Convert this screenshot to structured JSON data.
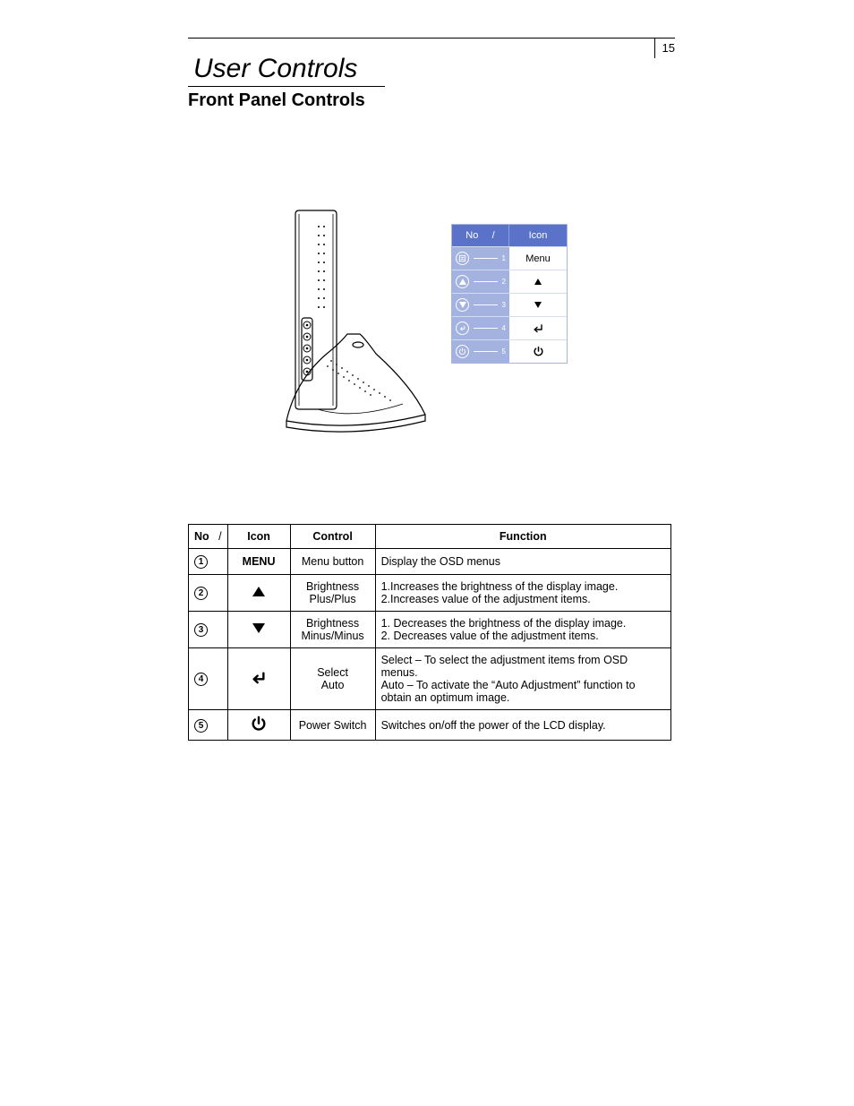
{
  "page_number": "15",
  "chapter_title": "User Controls",
  "section_title": "Front Panel Controls",
  "legend": {
    "head_no": "No",
    "head_slash": "/",
    "head_icon": "Icon",
    "rows": [
      {
        "num": "1",
        "icon_label": "Menu",
        "glyph": "menu"
      },
      {
        "num": "2",
        "icon_label": "",
        "glyph": "up"
      },
      {
        "num": "3",
        "icon_label": "",
        "glyph": "down"
      },
      {
        "num": "4",
        "icon_label": "",
        "glyph": "enter"
      },
      {
        "num": "5",
        "icon_label": "",
        "glyph": "power"
      }
    ]
  },
  "table": {
    "head": {
      "no": "No",
      "slash": "/",
      "icon": "Icon",
      "control": "Control",
      "function": "Function"
    },
    "rows": [
      {
        "num": "1",
        "icon_text": "MENU",
        "icon_glyph": "text",
        "control": "Menu button",
        "function": "Display the OSD menus"
      },
      {
        "num": "2",
        "icon_glyph": "up",
        "control": "Brightness Plus/Plus",
        "function": "1.Increases the brightness of the display image.\n2.Increases value of the adjustment items."
      },
      {
        "num": "3",
        "icon_glyph": "down",
        "control": "Brightness Minus/Minus",
        "function": "1. Decreases the brightness of the display image.\n2. Decreases value of the adjustment items."
      },
      {
        "num": "4",
        "icon_glyph": "enter",
        "control": "Select\nAuto",
        "function": "Select – To select the adjustment items from OSD menus.\nAuto – To activate the “Auto Adjustment” function to obtain an optimum image."
      },
      {
        "num": "5",
        "icon_glyph": "power",
        "control": "Power Switch",
        "function": "Switches on/off the power of the LCD display."
      }
    ]
  }
}
